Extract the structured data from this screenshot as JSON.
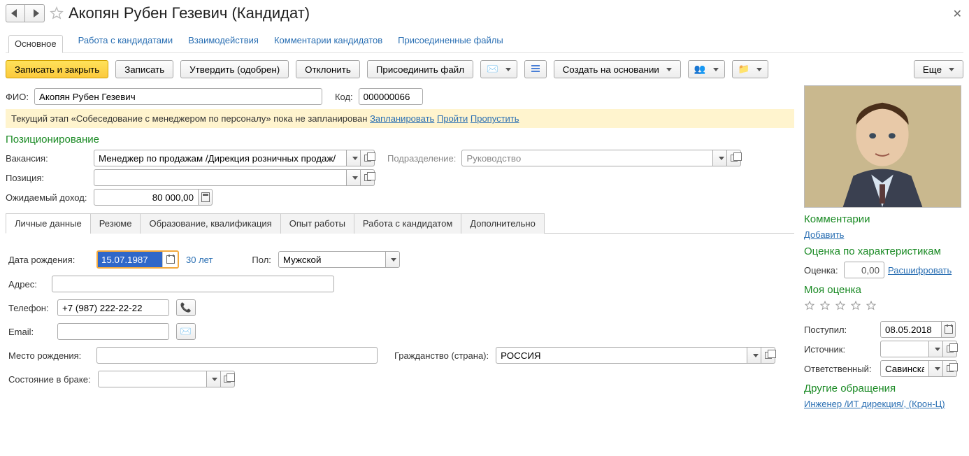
{
  "header": {
    "title": "Акопян Рубен Гезевич (Кандидат)"
  },
  "menuTabs": {
    "main": "Основное",
    "work": "Работа с кандидатами",
    "interact": "Взаимодействия",
    "comments": "Комментарии кандидатов",
    "files": "Присоединенные файлы"
  },
  "toolbar": {
    "save_close": "Записать и закрыть",
    "save": "Записать",
    "approve": "Утвердить (одобрен)",
    "reject": "Отклонить",
    "attach": "Присоединить файл",
    "create_basis": "Создать на основании",
    "more": "Еще"
  },
  "fields": {
    "fio_label": "ФИО:",
    "fio_value": "Акопян Рубен Гезевич",
    "code_label": "Код:",
    "code_value": "000000066"
  },
  "notice": {
    "text_before": "Текущий этап «Собеседование с менеджером по персоналу» пока не запланирован ",
    "plan": "Запланировать",
    "pass": "Пройти",
    "skip": "Пропустить"
  },
  "positioning": {
    "title": "Позиционирование",
    "vacancy_label": "Вакансия:",
    "vacancy_value": "Менеджер по продажам /Дирекция розничных продаж/",
    "department_label": "Подразделение:",
    "department_value": "Руководство",
    "position_label": "Позиция:",
    "income_label": "Ожидаемый доход:",
    "income_value": "80 000,00"
  },
  "tabs": {
    "personal": "Личные данные",
    "resume": "Резюме",
    "education": "Образование, квалификация",
    "experience": "Опыт работы",
    "work_with": "Работа с кандидатом",
    "extra": "Дополнительно"
  },
  "personal": {
    "birth_label": "Дата рождения:",
    "birth_value": "15.07.1987",
    "age": "30 лет",
    "gender_label": "Пол:",
    "gender_value": "Мужской",
    "address_label": "Адрес:",
    "phone_label": "Телефон:",
    "phone_value": "+7 (987) 222-22-22",
    "email_label": "Email:",
    "birthplace_label": "Место рождения:",
    "citizenship_label": "Гражданство (страна):",
    "citizenship_value": "РОССИЯ",
    "marital_label": "Состояние в браке:"
  },
  "side": {
    "comments_title": "Комментарии",
    "add_link": "Добавить",
    "rating_title": "Оценка по характеристикам",
    "rating_label": "Оценка:",
    "rating_value": "0,00",
    "decode": "Расшифровать",
    "my_rating": "Моя оценка",
    "received_label": "Поступил:",
    "received_value": "08.05.2018",
    "source_label": "Источник:",
    "responsible_label": "Ответственный:",
    "responsible_value": "Савинская З.",
    "other_title": "Другие обращения",
    "other_link": "Инженер /ИТ дирекция/, (Крон-Ц)"
  }
}
